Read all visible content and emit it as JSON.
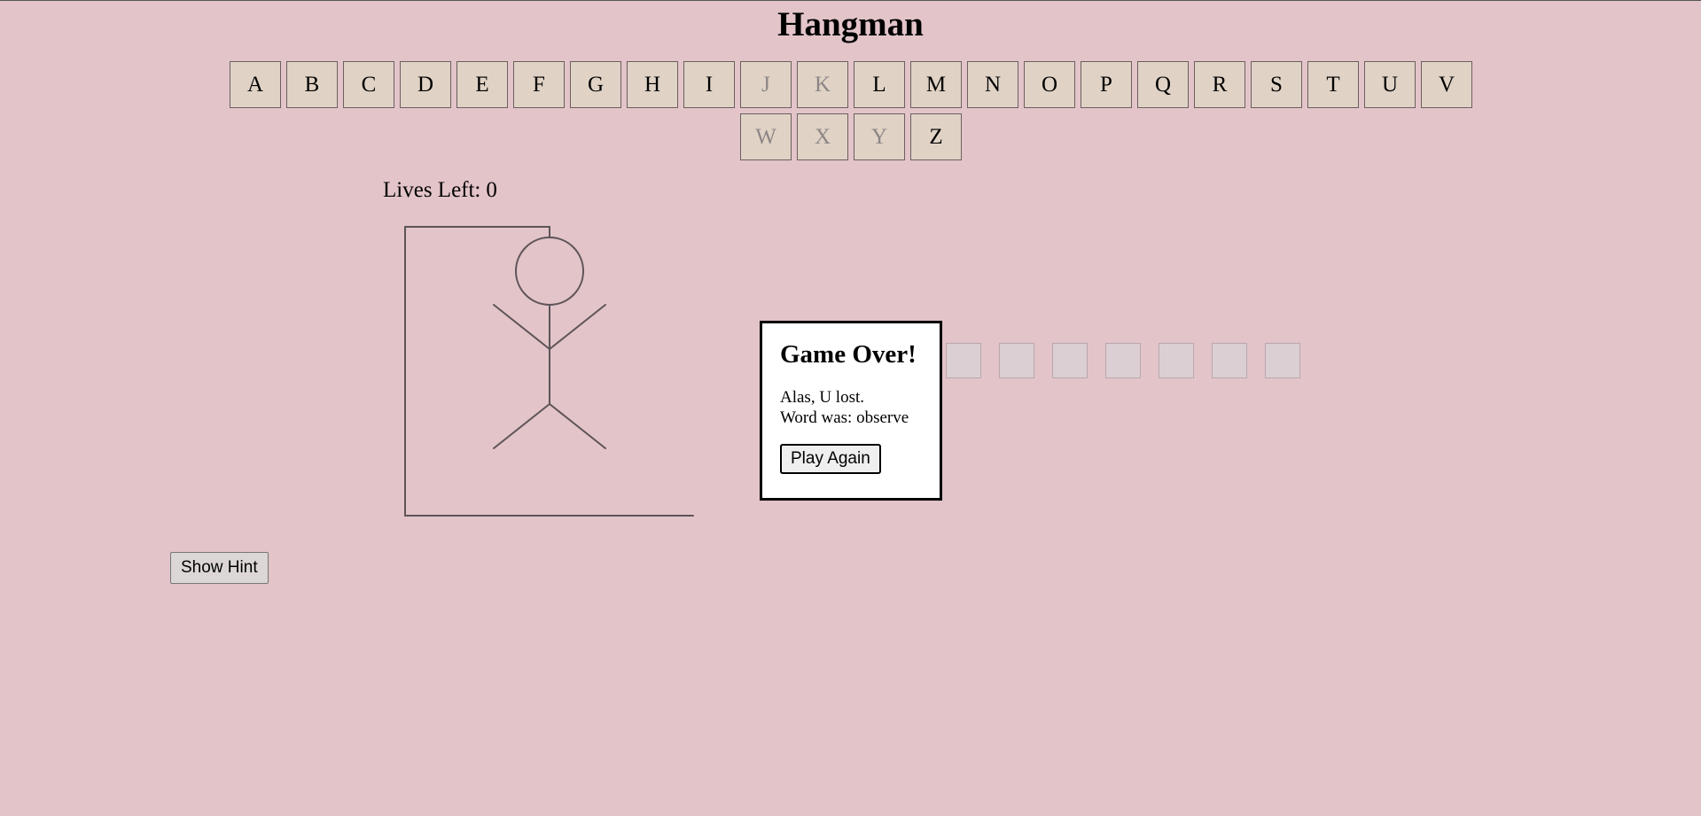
{
  "page": {
    "title": "Hangman"
  },
  "keyboard": {
    "letters": [
      {
        "label": "A",
        "used": false
      },
      {
        "label": "B",
        "used": false
      },
      {
        "label": "C",
        "used": false
      },
      {
        "label": "D",
        "used": false
      },
      {
        "label": "E",
        "used": false
      },
      {
        "label": "F",
        "used": false
      },
      {
        "label": "G",
        "used": false
      },
      {
        "label": "H",
        "used": false
      },
      {
        "label": "I",
        "used": false
      },
      {
        "label": "J",
        "used": true
      },
      {
        "label": "K",
        "used": true
      },
      {
        "label": "L",
        "used": false
      },
      {
        "label": "M",
        "used": false
      },
      {
        "label": "N",
        "used": false
      },
      {
        "label": "O",
        "used": false
      },
      {
        "label": "P",
        "used": false
      },
      {
        "label": "Q",
        "used": false
      },
      {
        "label": "R",
        "used": false
      },
      {
        "label": "S",
        "used": false
      },
      {
        "label": "T",
        "used": false
      },
      {
        "label": "U",
        "used": false
      },
      {
        "label": "V",
        "used": false
      },
      {
        "label": "W",
        "used": true
      },
      {
        "label": "X",
        "used": true
      },
      {
        "label": "Y",
        "used": true
      },
      {
        "label": "Z",
        "used": false
      }
    ]
  },
  "status": {
    "lives_label": "Lives Left:",
    "lives_value": "0"
  },
  "modal": {
    "title": "Game Over!",
    "line1": "Alas, U lost.",
    "line2": "Word was: observe",
    "play_again_label": "Play Again"
  },
  "word": {
    "slots": [
      "",
      "",
      "",
      "",
      "",
      "",
      ""
    ]
  },
  "hint": {
    "button_label": "Show Hint"
  },
  "colors": {
    "background": "#e2c4c9",
    "key_bg": "#e0d3c6",
    "key_used_text": "#8d8686",
    "drawing_stroke": "#5e5458"
  }
}
